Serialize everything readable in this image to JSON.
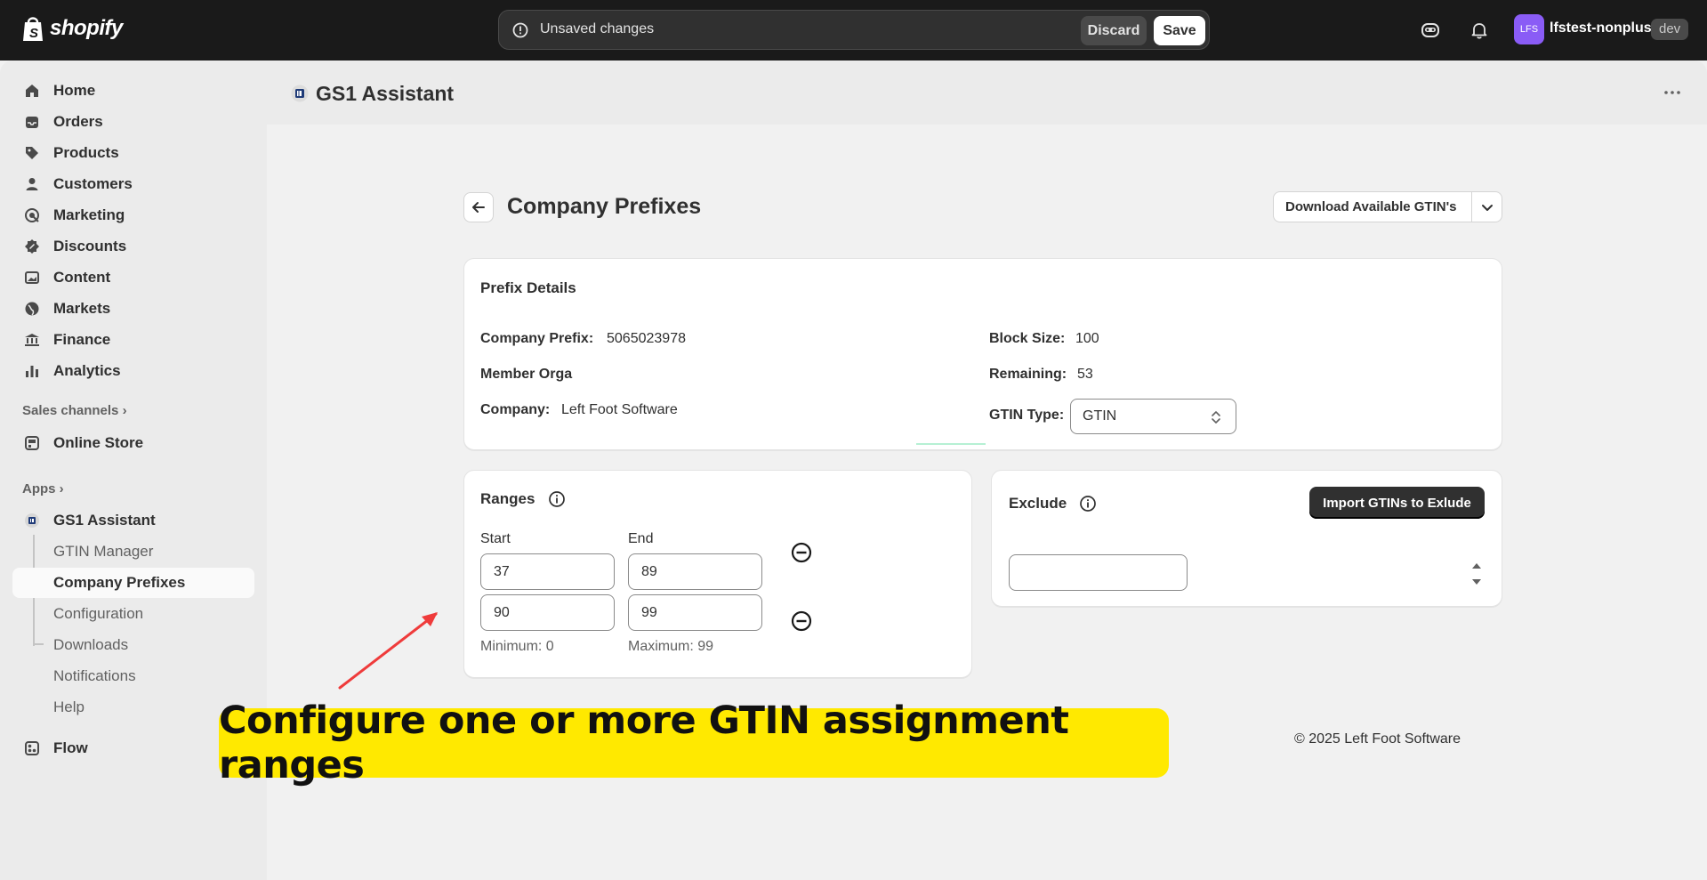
{
  "topbar": {
    "brand": "shopify",
    "unsaved_text": "Unsaved changes",
    "discard_label": "Discard",
    "save_label": "Save",
    "avatar_initials": "LFS",
    "store_name": "lfstest-nonplus",
    "env_badge": "dev"
  },
  "sidebar": {
    "main_items": [
      {
        "label": "Home",
        "icon": "home-icon"
      },
      {
        "label": "Orders",
        "icon": "inbox-icon"
      },
      {
        "label": "Products",
        "icon": "tag-icon"
      },
      {
        "label": "Customers",
        "icon": "person-icon"
      },
      {
        "label": "Marketing",
        "icon": "target-icon"
      },
      {
        "label": "Discounts",
        "icon": "discount-icon"
      },
      {
        "label": "Content",
        "icon": "image-icon"
      },
      {
        "label": "Markets",
        "icon": "globe-icon"
      },
      {
        "label": "Finance",
        "icon": "bank-icon"
      },
      {
        "label": "Analytics",
        "icon": "chart-icon"
      }
    ],
    "sales_channels_heading": "Sales channels",
    "online_store": "Online Store",
    "apps_heading": "Apps",
    "app_name": "GS1 Assistant",
    "app_sub_items": [
      "GTIN Manager",
      "Company Prefixes",
      "Configuration",
      "Downloads",
      "Notifications",
      "Help"
    ],
    "active_sub_item": "Company Prefixes",
    "flow": "Flow"
  },
  "app_header": {
    "title": "GS1 Assistant"
  },
  "page": {
    "title": "Company Prefixes",
    "download_button": "Download Available GTIN's"
  },
  "prefix_details": {
    "heading": "Prefix Details",
    "company_prefix_label": "Company Prefix:",
    "company_prefix_value": "5065023978",
    "member_org_label": "Member Orga",
    "company_label": "Company:",
    "company_value": "Left Foot Software",
    "block_size_label": "Block Size:",
    "block_size_value": "100",
    "remaining_label": "Remaining:",
    "remaining_value": "53",
    "gtin_type_label": "GTIN Type:",
    "gtin_type_value": "GTIN"
  },
  "ranges": {
    "heading": "Ranges",
    "start_label": "Start",
    "end_label": "End",
    "rows": [
      {
        "start": "37",
        "end": "89"
      },
      {
        "start": "90",
        "end": "99"
      }
    ],
    "minimum_text": "Minimum: 0",
    "maximum_text": "Maximum: 99"
  },
  "exclude": {
    "heading": "Exclude",
    "import_button": "Import GTINs to Exlude",
    "input_value": ""
  },
  "footer": {
    "copyright": "© 2025 Left Foot Software"
  },
  "callout": {
    "text": "Configure one or more GTIN assignment ranges",
    "background": "#ffe900",
    "arrow_color": "#ef3b3b"
  }
}
